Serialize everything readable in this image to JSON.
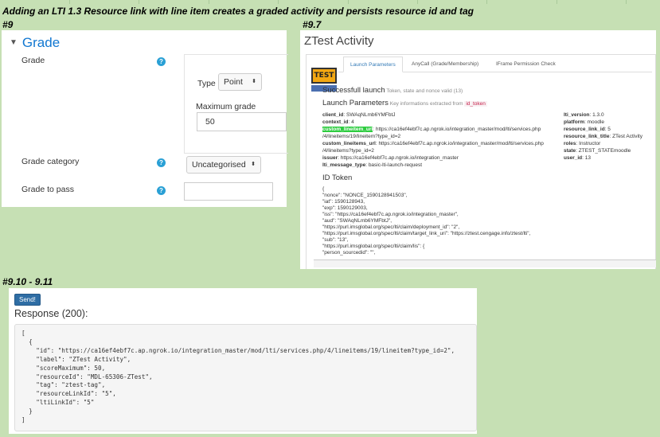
{
  "caption_main": "Adding an LTI 1.3 Resource link with line item creates a graded activity and persists resource id and tag",
  "caption_9": "#9",
  "caption_97": "#9.7",
  "caption_910": "#9.10 - 9.11",
  "grade_form": {
    "section_title": "Grade",
    "grade_label": "Grade",
    "type_label": "Type",
    "type_value": "Point",
    "max_grade_label": "Maximum grade",
    "max_grade_value": "50",
    "category_label": "Grade category",
    "category_value": "Uncategorised",
    "pass_label": "Grade to pass",
    "pass_value": ""
  },
  "ztest": {
    "title": "ZTest Activity",
    "logo_text": "TEST",
    "tabs": [
      "Launch Parameters",
      "AnyCall (Grade/Membership)",
      "IFrame Permission Check"
    ],
    "success_title": "Successfull launch",
    "success_note": "Token, state and nonce valid (13)",
    "launch_title": "Launch Parameters",
    "launch_note": "Key informations extracted from",
    "launch_token": "id_token",
    "left_params": [
      {
        "k": "client_id",
        "v": ": SWAqNLmb6YMFbtJ"
      },
      {
        "k": "context_id",
        "v": ": 4"
      },
      {
        "k": "custom_lineitem_url",
        "v": ": https://ca16ef4ebf7c.ap.ngrok.io/integration_master/mod/lti/services.php"
      },
      {
        "k": "",
        "v": "/4/lineitems/19/lineitem?type_id=2"
      },
      {
        "k": "custom_lineitems_url",
        "v": ": https://ca16ef4ebf7c.ap.ngrok.io/integration_master/mod/lti/services.php"
      },
      {
        "k": "",
        "v": "/4/lineitems?type_id=2"
      },
      {
        "k": "issuer",
        "v": ": https://ca16ef4ebf7c.ap.ngrok.io/integration_master"
      },
      {
        "k": "lti_message_type",
        "v": ": basic-lti-launch-request"
      }
    ],
    "right_params": [
      {
        "k": "lti_version",
        "v": ": 1.3.0"
      },
      {
        "k": "platform",
        "v": ": moodle"
      },
      {
        "k": "resource_link_id",
        "v": ": 5"
      },
      {
        "k": "resource_link_title",
        "v": ": ZTest Activity"
      },
      {
        "k": "roles",
        "v": ": Instructor"
      },
      {
        "k": "state",
        "v": ": ZTEST_STATEmoodle"
      },
      {
        "k": "user_id",
        "v": ": 13"
      }
    ],
    "id_token_title": "ID Token",
    "id_token_lines": [
      "{",
      "  \"nonce\": \"NONCE_1590128941503\",",
      "  \"iat\": 1590128943,",
      "  \"exp\": 1590129003,",
      "  \"iss\": \"https://ca16ef4ebf7c.ap.ngrok.io/integration_master\",",
      "  \"aud\": \"SWAqNLmb6YMFbtJ\",",
      "  \"https://purl.imsglobal.org/spec/lti/claim/deployment_id\": \"2\",",
      "  \"https://purl.imsglobal.org/spec/lti/claim/target_link_uri\": \"https://ztest.cengage.info/ztest/lti\",",
      "  \"sub\": \"13\",",
      "  \"https://purl.imsglobal.org/spec/lti/claim/lis\": {",
      "    \"person_sourcedid\": \"\","
    ]
  },
  "response": {
    "send_label": "Send!",
    "status": "Response (200):",
    "body": "[\n  {\n    \"id\": \"https://ca16ef4ebf7c.ap.ngrok.io/integration_master/mod/lti/services.php/4/lineitems/19/lineitem?type_id=2\",\n    \"label\": \"ZTest Activity\",\n    \"scoreMaximum\": 50,\n    \"resourceId\": \"MDL-65306-ZTest\",\n    \"tag\": \"ztest-tag\",\n    \"resourceLinkId\": \"5\",\n    \"ltiLinkId\": \"5\"\n  }\n]"
  }
}
